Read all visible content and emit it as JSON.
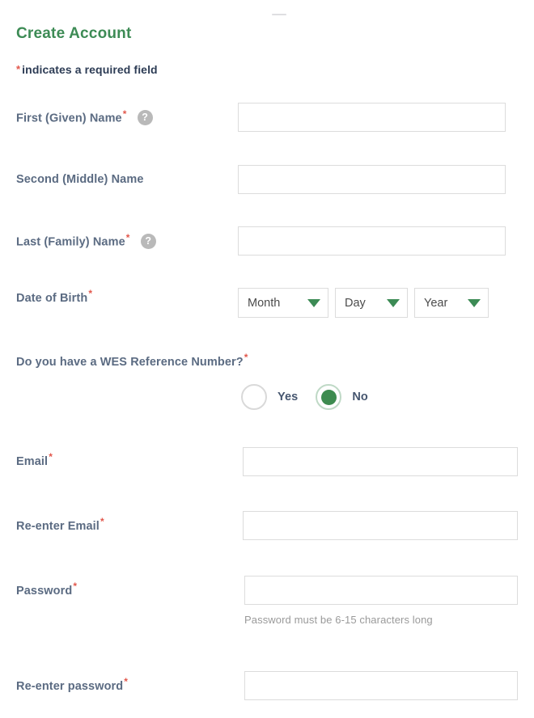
{
  "page": {
    "heading": "Create Account",
    "required_note_label": "indicates a required field",
    "required_marker": "*",
    "accent_green": "#3d8b55",
    "required_red": "#e2574c",
    "label_color": "#5b6b82",
    "border_color": "#dcdcdc"
  },
  "fields": {
    "first_name": {
      "label": "First (Given) Name",
      "required": "*",
      "help_icon": "question-mark-icon",
      "help_glyph": "?",
      "value": "",
      "placeholder": ""
    },
    "middle_name": {
      "label": "Second (Middle) Name",
      "required": "",
      "value": "",
      "placeholder": ""
    },
    "last_name": {
      "label": "Last (Family) Name",
      "required": "*",
      "help_icon": "question-mark-icon",
      "help_glyph": "?",
      "value": "",
      "placeholder": ""
    },
    "date_of_birth": {
      "label": "Date of Birth",
      "required": "*",
      "month": {
        "selected": "Month",
        "caret_icon": "chevron-down-icon"
      },
      "day": {
        "selected": "Day",
        "caret_icon": "chevron-down-icon"
      },
      "year": {
        "selected": "Year",
        "caret_icon": "chevron-down-icon"
      }
    },
    "wes_reference": {
      "label": "Do you have a WES Reference Number?",
      "required": "*",
      "options": [
        {
          "label": "Yes",
          "selected": false
        },
        {
          "label": "No",
          "selected": true
        }
      ]
    },
    "email": {
      "label": "Email",
      "required": "*",
      "value": "",
      "placeholder": ""
    },
    "reenter_email": {
      "label": "Re-enter Email",
      "required": "*",
      "value": "",
      "placeholder": ""
    },
    "password": {
      "label": "Password",
      "required": "*",
      "value": "",
      "placeholder": "",
      "helper_text": "Password must be 6-15 characters long"
    },
    "reenter_password": {
      "label": "Re-enter password",
      "required": "*",
      "value": "",
      "placeholder": ""
    }
  }
}
